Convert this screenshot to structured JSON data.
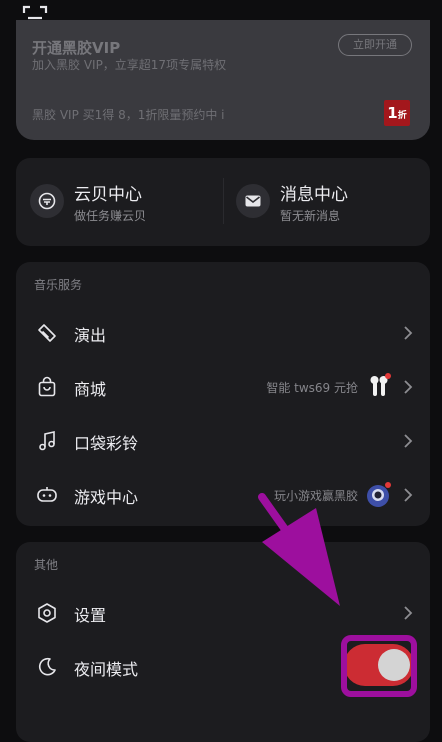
{
  "vip": {
    "title": "开通黑胶VIP",
    "pill": "立即开通",
    "subtitle": "加入黑胶 VIP，立享超17项专属特权",
    "promo": "黑胶 VIP 买1得 8，1折限量预约中 i",
    "badge": "1",
    "badge_small": "折"
  },
  "hub": {
    "left": {
      "title": "云贝中心",
      "subtitle": "做任务赚云贝",
      "icon": "cloud-coin-icon"
    },
    "right": {
      "title": "消息中心",
      "subtitle": "暂无新消息",
      "icon": "mail-icon"
    }
  },
  "music": {
    "label": "音乐服务",
    "rows": [
      {
        "label": "演出",
        "icon": "ticket-icon"
      },
      {
        "label": "商城",
        "hint": "智能 tws69 元抢",
        "icon": "shopping-bag-icon"
      },
      {
        "label": "口袋彩铃",
        "icon": "music-note-icon"
      },
      {
        "label": "游戏中心",
        "hint": "玩小游戏赢黑胶",
        "icon": "gamepad-icon"
      }
    ]
  },
  "others": {
    "label": "其他",
    "rows": [
      {
        "label": "设置",
        "icon": "gear-icon"
      },
      {
        "label": "夜间模式",
        "icon": "moon-icon",
        "toggle_on": true
      }
    ]
  },
  "colors": {
    "accent": "#cc2c33",
    "annotation": "#9d0f9e",
    "background": "#0d0d0f",
    "card": "#1c1c1f"
  }
}
